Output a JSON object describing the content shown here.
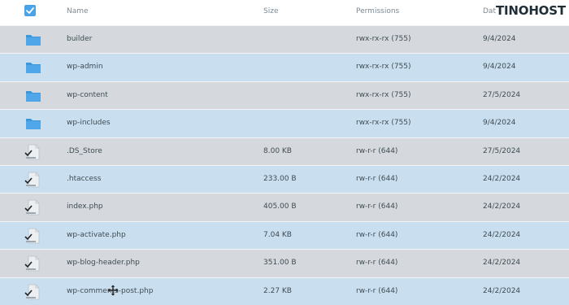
{
  "header": {
    "name": "Name",
    "size": "Size",
    "permissions": "Permissions",
    "date": "Dat",
    "brand": "TINOHOST"
  },
  "rows": [
    {
      "name": "builder",
      "size": "",
      "permissions": "rwx-rx-rx (755)",
      "date": "9/4/2024",
      "type": "folder"
    },
    {
      "name": "wp-admin",
      "size": "",
      "permissions": "rwx-rx-rx (755)",
      "date": "9/4/2024",
      "type": "folder"
    },
    {
      "name": "wp-content",
      "size": "",
      "permissions": "rwx-rx-rx (755)",
      "date": "27/5/2024",
      "type": "folder"
    },
    {
      "name": "wp-includes",
      "size": "",
      "permissions": "rwx-rx-rx (755)",
      "date": "9/4/2024",
      "type": "folder"
    },
    {
      "name": ".DS_Store",
      "size": "8.00 KB",
      "permissions": "rw-r-r (644)",
      "date": "27/5/2024",
      "type": "file"
    },
    {
      "name": ".htaccess",
      "size": "233.00 B",
      "permissions": "rw-r-r (644)",
      "date": "24/2/2024",
      "type": "file"
    },
    {
      "name": "index.php",
      "size": "405.00 B",
      "permissions": "rw-r-r (644)",
      "date": "24/2/2024",
      "type": "file"
    },
    {
      "name": "wp-activate.php",
      "size": "7.04 KB",
      "permissions": "rw-r-r (644)",
      "date": "24/2/2024",
      "type": "file"
    },
    {
      "name": "wp-blog-header.php",
      "size": "351.00 B",
      "permissions": "rw-r-r (644)",
      "date": "24/2/2024",
      "type": "file"
    },
    {
      "name": "wp-comments-post.php",
      "size": "2.27 KB",
      "permissions": "rw-r-r (644)",
      "date": "24/2/2024",
      "type": "file"
    }
  ],
  "colors": {
    "accent": "#4aa3e6",
    "row_even": "#d5d9de",
    "row_odd": "#c9dff0"
  }
}
